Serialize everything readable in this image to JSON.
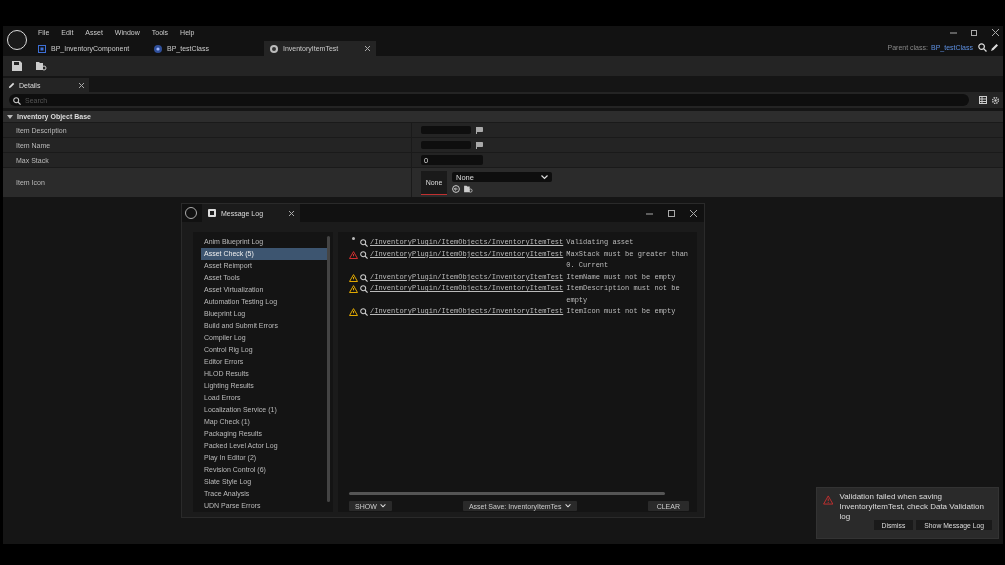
{
  "menu": [
    "File",
    "Edit",
    "Asset",
    "Window",
    "Tools",
    "Help"
  ],
  "tabs": [
    {
      "label": "BP_InventoryComponent",
      "kind": "component",
      "selected": false
    },
    {
      "label": "BP_testClass",
      "kind": "class",
      "selected": false
    },
    {
      "label": "InventoryItemTest",
      "kind": "item",
      "selected": true
    }
  ],
  "parent_class": {
    "label": "Parent class:",
    "value": "BP_testClass"
  },
  "details": {
    "tab": "Details",
    "search": {
      "placeholder": "Search"
    },
    "category": {
      "title": "Inventory Object Base",
      "expanded": true,
      "properties": [
        {
          "name": "Item Description",
          "kind": "text"
        },
        {
          "name": "Item Name",
          "kind": "text"
        },
        {
          "name": "Max Stack",
          "kind": "number",
          "value": "0"
        },
        {
          "name": "Item Icon",
          "kind": "asset",
          "thumbnail": "None",
          "value": "None"
        }
      ]
    }
  },
  "message_log": {
    "title": "Message Log",
    "categories": [
      {
        "label": "Anim Blueprint Log",
        "selected": false
      },
      {
        "label": "Asset Check (5)",
        "selected": true
      },
      {
        "label": "Asset Reimport",
        "selected": false
      },
      {
        "label": "Asset Tools",
        "selected": false
      },
      {
        "label": "Asset Virtualization",
        "selected": false
      },
      {
        "label": "Automation Testing Log",
        "selected": false
      },
      {
        "label": "Blueprint Log",
        "selected": false
      },
      {
        "label": "Build and Submit Errors",
        "selected": false
      },
      {
        "label": "Compiler Log",
        "selected": false
      },
      {
        "label": "Control Rig Log",
        "selected": false
      },
      {
        "label": "Editor Errors",
        "selected": false
      },
      {
        "label": "HLOD Results",
        "selected": false
      },
      {
        "label": "Lighting Results",
        "selected": false
      },
      {
        "label": "Load Errors",
        "selected": false
      },
      {
        "label": "Localization Service (1)",
        "selected": false
      },
      {
        "label": "Map Check (1)",
        "selected": false
      },
      {
        "label": "Packaging Results",
        "selected": false
      },
      {
        "label": "Packed Level Actor Log",
        "selected": false
      },
      {
        "label": "Play In Editor (2)",
        "selected": false
      },
      {
        "label": "Revision Control (6)",
        "selected": false
      },
      {
        "label": "Slate Style Log",
        "selected": false
      },
      {
        "label": "Trace Analysis",
        "selected": false
      },
      {
        "label": "UDN Parse Errors",
        "selected": false
      }
    ],
    "entries": [
      {
        "kind": "info",
        "path": "/InventoryPlugin/ItemObjects/InventoryItemTest",
        "message": "Validating asset"
      },
      {
        "kind": "error",
        "path": "/InventoryPlugin/ItemObjects/InventoryItemTest",
        "message": "MaxStack must be greater than 0. Current"
      },
      {
        "kind": "warning",
        "path": "/InventoryPlugin/ItemObjects/InventoryItemTest",
        "message": "ItemName must not be empty"
      },
      {
        "kind": "warning",
        "path": "/InventoryPlugin/ItemObjects/InventoryItemTest",
        "message": "ItemDescription must not be empty"
      },
      {
        "kind": "warning",
        "path": "/InventoryPlugin/ItemObjects/InventoryItemTest",
        "message": "ItemIcon must not be empty"
      }
    ],
    "show_button": "SHOW",
    "page_button": "Asset Save: InventoryItemTes",
    "clear_button": "CLEAR"
  },
  "toast": {
    "message": "Validation failed when saving InventoryItemTest, check Data Validation log",
    "buttons": [
      "Dismiss",
      "Show Message Log"
    ]
  }
}
